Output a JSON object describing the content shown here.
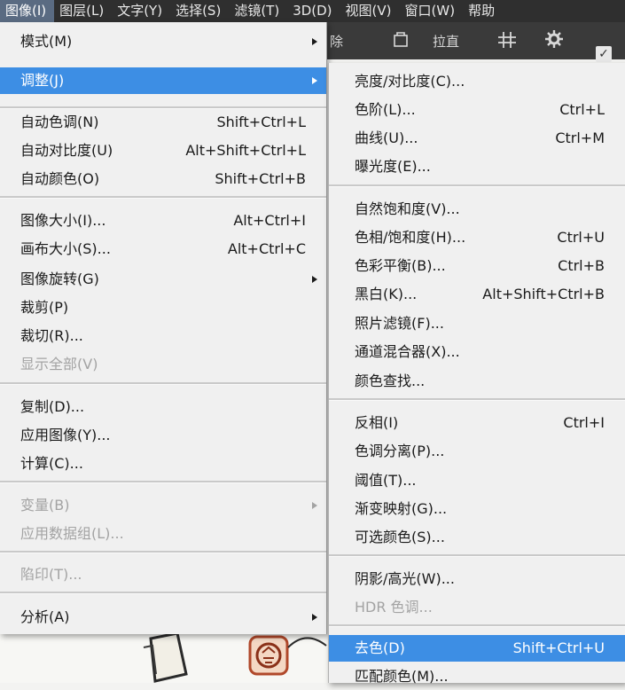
{
  "menubar": [
    "图像(I)",
    "图层(L)",
    "文字(Y)",
    "选择(S)",
    "滤镜(T)",
    "3D(D)",
    "视图(V)",
    "窗口(W)",
    "帮助"
  ],
  "toolbar": {
    "label1": "除",
    "label2": "拉直"
  },
  "image_menu": {
    "mode": "模式(M)",
    "adjust": "调整(J)",
    "auto_tone": {
      "label": "自动色调(N)",
      "shortcut": "Shift+Ctrl+L"
    },
    "auto_contrast": {
      "label": "自动对比度(U)",
      "shortcut": "Alt+Shift+Ctrl+L"
    },
    "auto_color": {
      "label": "自动颜色(O)",
      "shortcut": "Shift+Ctrl+B"
    },
    "image_size": {
      "label": "图像大小(I)...",
      "shortcut": "Alt+Ctrl+I"
    },
    "canvas_size": {
      "label": "画布大小(S)...",
      "shortcut": "Alt+Ctrl+C"
    },
    "rotation": "图像旋转(G)",
    "crop": "裁剪(P)",
    "trim": "裁切(R)...",
    "reveal_all": "显示全部(V)",
    "duplicate": "复制(D)...",
    "apply_image": "应用图像(Y)...",
    "calculations": "计算(C)...",
    "variables": "变量(B)",
    "apply_dataset": "应用数据组(L)...",
    "trap": "陷印(T)...",
    "analysis": "分析(A)"
  },
  "adjust_menu": {
    "brightness": "亮度/对比度(C)...",
    "levels": {
      "label": "色阶(L)...",
      "shortcut": "Ctrl+L"
    },
    "curves": {
      "label": "曲线(U)...",
      "shortcut": "Ctrl+M"
    },
    "exposure": "曝光度(E)...",
    "vibrance": "自然饱和度(V)...",
    "hue_sat": {
      "label": "色相/饱和度(H)...",
      "shortcut": "Ctrl+U"
    },
    "color_balance": {
      "label": "色彩平衡(B)...",
      "shortcut": "Ctrl+B"
    },
    "black_white": {
      "label": "黑白(K)...",
      "shortcut": "Alt+Shift+Ctrl+B"
    },
    "photo_filter": "照片滤镜(F)...",
    "channel_mixer": "通道混合器(X)...",
    "color_lookup": "颜色查找...",
    "invert": {
      "label": "反相(I)",
      "shortcut": "Ctrl+I"
    },
    "posterize": "色调分离(P)...",
    "threshold": "阈值(T)...",
    "gradient_map": "渐变映射(G)...",
    "selective_color": "可选颜色(S)...",
    "shadows_highlights": "阴影/高光(W)...",
    "hdr_toning": "HDR 色调...",
    "desaturate": {
      "label": "去色(D)",
      "shortcut": "Shift+Ctrl+U"
    },
    "match_color": "匹配颜色(M)..."
  },
  "colors": {
    "highlight": "#3d8ee4",
    "menubar": "#2f2f2f",
    "menu_bg": "#f0f0f0"
  }
}
